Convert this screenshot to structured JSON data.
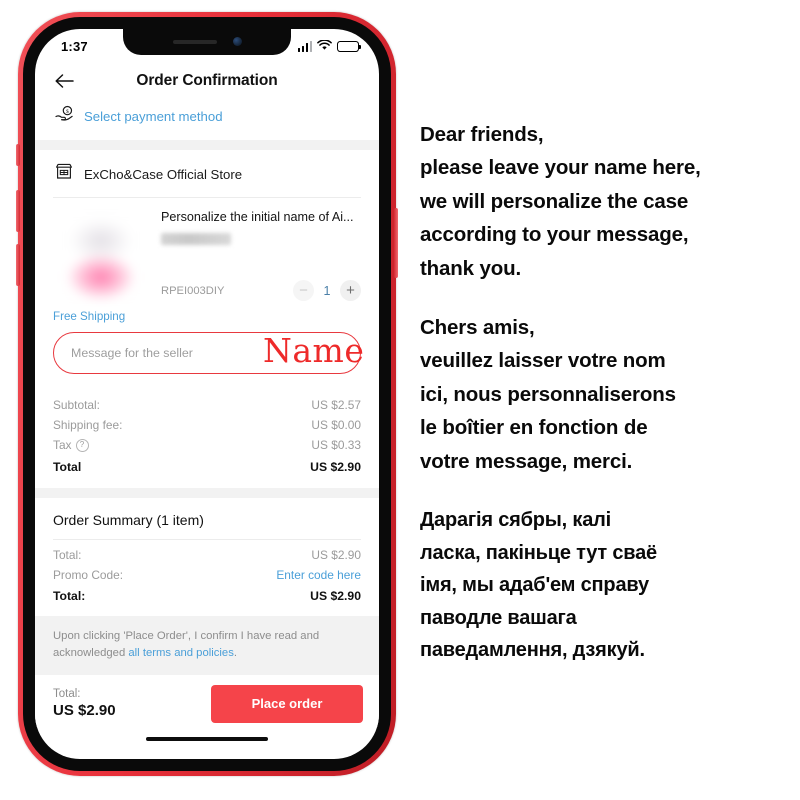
{
  "phone": {
    "status_bar": {
      "time": "1:37",
      "signal_icon": "signal-bars-icon",
      "wifi_icon": "wifi-icon",
      "battery_icon": "battery-full-icon"
    },
    "header": {
      "back_icon": "back-arrow-icon",
      "title": "Order Confirmation"
    },
    "payment": {
      "icon": "hand-holding-money-icon",
      "label": "Select payment method"
    },
    "store": {
      "icon": "storefront-icon",
      "name": "ExCho&Case Official Store"
    },
    "product": {
      "image_alt": "blurred-product-thumbnail",
      "title": "Personalize the initial name of Ai...",
      "variant": "",
      "sku": "RPEI003DIY",
      "quantity": "1",
      "minus_label": "−",
      "plus_label": "+",
      "shipping_badge": "Free Shipping"
    },
    "message_input": {
      "placeholder": "Message for the seller",
      "value": "",
      "annotation": "Name",
      "annotation_color": "#ee2a2a",
      "border_color": "#e8393f"
    },
    "price_breakdown": [
      {
        "label": "Subtotal:",
        "value": "US $2.57",
        "bold": false,
        "help": false
      },
      {
        "label": "Shipping fee:",
        "value": "US $0.00",
        "bold": false,
        "help": false
      },
      {
        "label": "Tax",
        "value": "US $0.33",
        "bold": false,
        "help": true
      },
      {
        "label": "Total",
        "value": "US $2.90",
        "bold": true,
        "help": false
      }
    ],
    "order_summary": {
      "title": "Order Summary (1 item)",
      "lines": [
        {
          "label": "Total:",
          "value": "US $2.90",
          "bold": false,
          "link": false
        },
        {
          "label": "Promo Code:",
          "value": "Enter code here",
          "bold": false,
          "link": true
        },
        {
          "label": "Total:",
          "value": "US $2.90",
          "bold": true,
          "link": false
        }
      ]
    },
    "terms": {
      "prefix": "Upon clicking 'Place Order', I confirm I have read and acknowledged ",
      "link": "all terms and policies",
      "suffix": "."
    },
    "bottom_bar": {
      "total_label": "Total:",
      "total_value": "US $2.90",
      "place_order_label": "Place order",
      "button_color": "#f5444a"
    }
  },
  "instructions": {
    "blocks": [
      {
        "lang": "english",
        "lines": [
          "Dear friends,",
          "please leave your name here,",
          "we will personalize the case",
          "according to your message,",
          "thank you."
        ]
      },
      {
        "lang": "french",
        "lines": [
          "Chers amis,",
          "veuillez laisser votre nom",
          "ici, nous personnaliserons",
          "le boîtier en fonction de",
          "votre message, merci."
        ]
      },
      {
        "lang": "belarusian",
        "lines": [
          "Дарагія сябры, калі",
          "ласка, пакіньце тут сваё",
          "імя, мы адаб'ем справу",
          "паводле вашага",
          "паведамлення, дзякуй."
        ]
      }
    ]
  }
}
